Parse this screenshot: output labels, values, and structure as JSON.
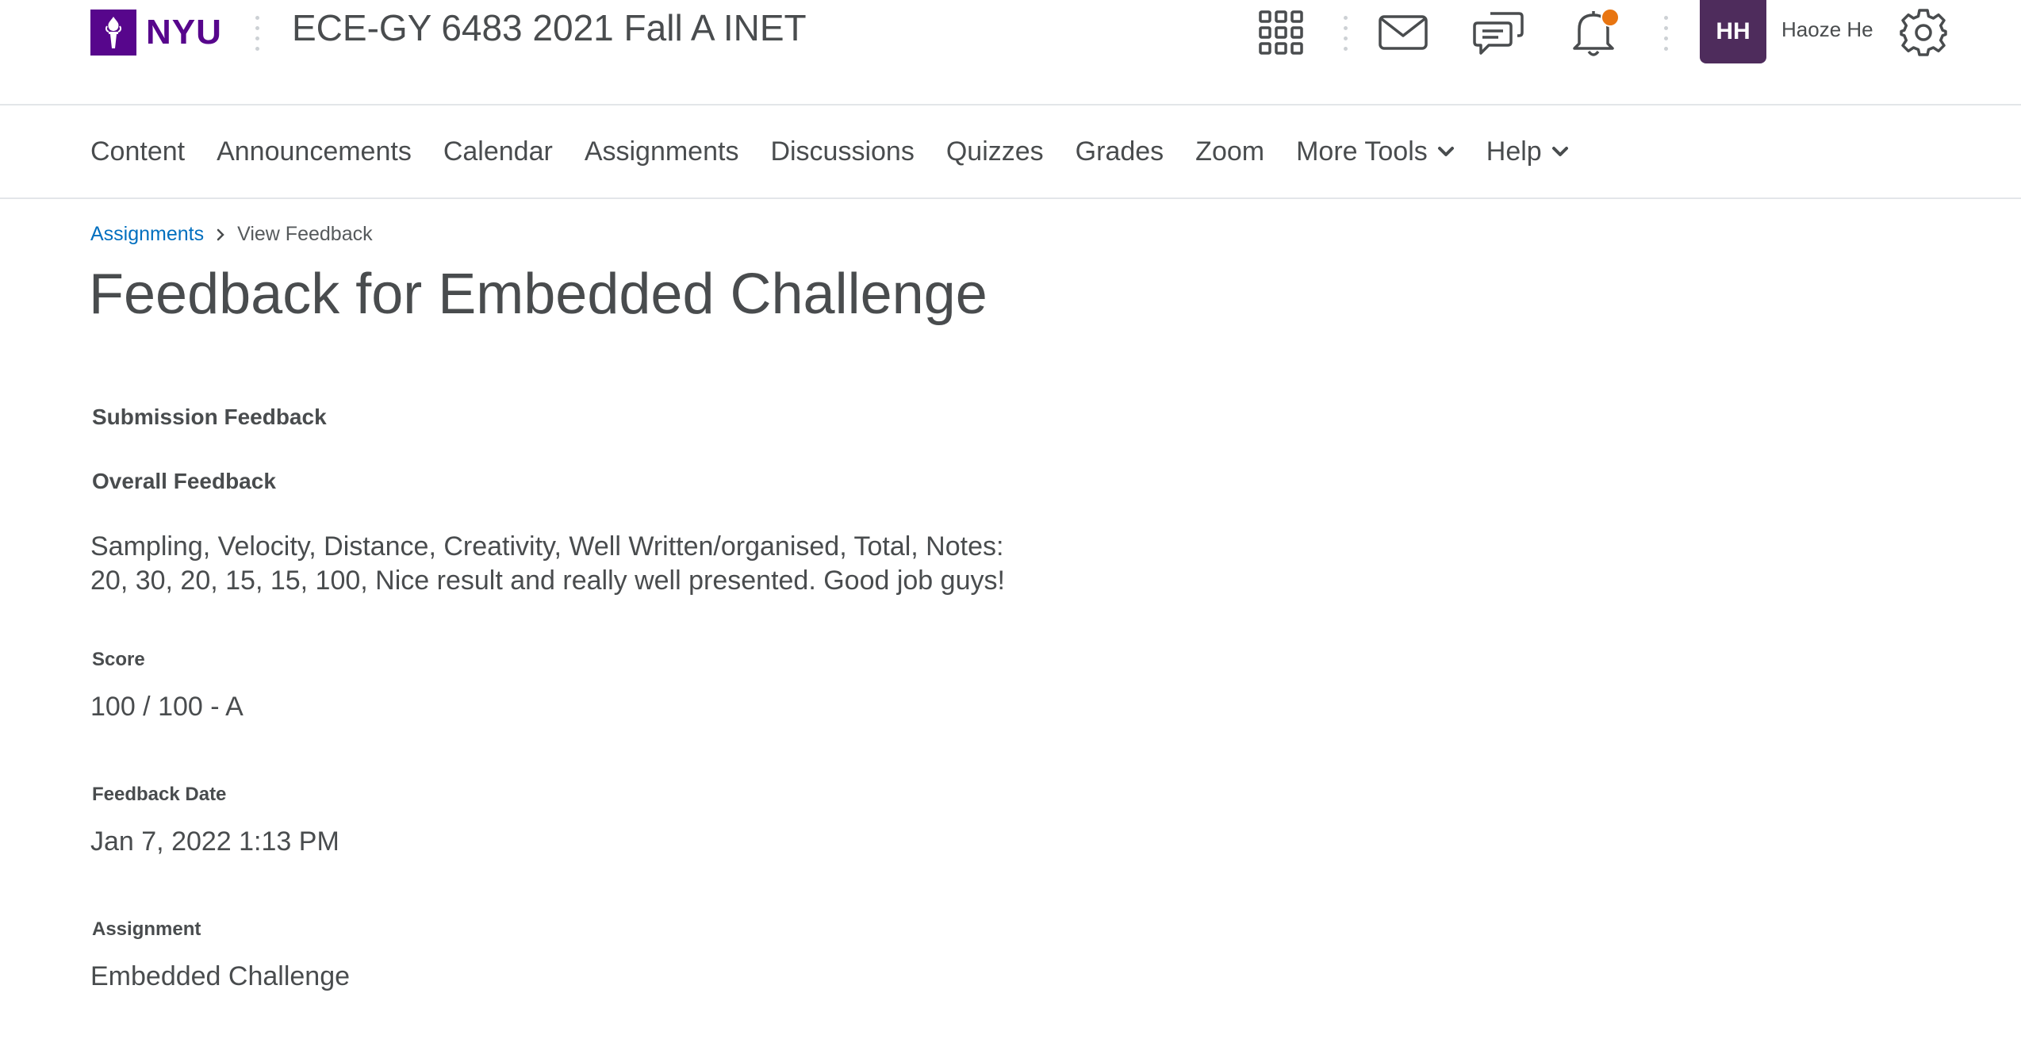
{
  "header": {
    "logo_text": "NYU",
    "course_title": "ECE-GY 6483 2021 Fall A INET",
    "avatar_initials": "HH",
    "user_name": "Haoze He",
    "icons": [
      "waffle-icon",
      "mail-icon",
      "chat-icon",
      "bell-icon",
      "gear-icon"
    ],
    "notification_color": "#e87511",
    "brand_color": "#57068c",
    "avatar_color": "#4e2c5c"
  },
  "nav": {
    "items": [
      "Content",
      "Announcements",
      "Calendar",
      "Assignments",
      "Discussions",
      "Quizzes",
      "Grades",
      "Zoom",
      "More Tools",
      "Help"
    ]
  },
  "breadcrumb": {
    "link": "Assignments",
    "current": "View Feedback",
    "link_color": "#006fbf"
  },
  "page": {
    "title": "Feedback for Embedded Challenge",
    "submission_feedback_label": "Submission Feedback",
    "overall_feedback_label": "Overall Feedback",
    "overall_feedback_lines": [
      "Sampling, Velocity, Distance, Creativity, Well Written/organised, Total, Notes:",
      "20, 30, 20, 15, 15, 100, Nice result and really well presented. Good job guys!"
    ],
    "score_label": "Score",
    "score_value": "100 / 100 - A",
    "feedback_date_label": "Feedback Date",
    "feedback_date_value": "Jan 7, 2022 1:13 PM",
    "assignment_label": "Assignment",
    "assignment_value": "Embedded Challenge"
  }
}
